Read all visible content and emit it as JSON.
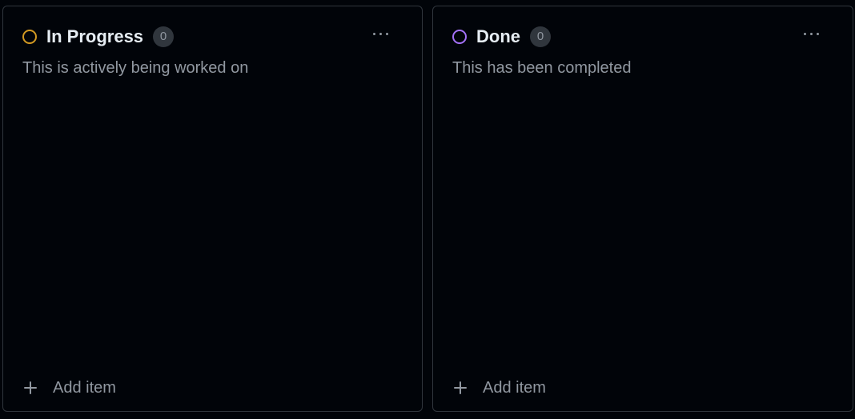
{
  "columns": [
    {
      "title": "In Progress",
      "count": "0",
      "description": "This is actively being worked on",
      "status_color": "#d29922",
      "add_label": "Add item"
    },
    {
      "title": "Done",
      "count": "0",
      "description": "This has been completed",
      "status_color": "#a371f7",
      "add_label": "Add item"
    }
  ],
  "icons": {
    "status": "circle-icon",
    "more": "more-horizontal-icon",
    "add": "plus-icon"
  }
}
